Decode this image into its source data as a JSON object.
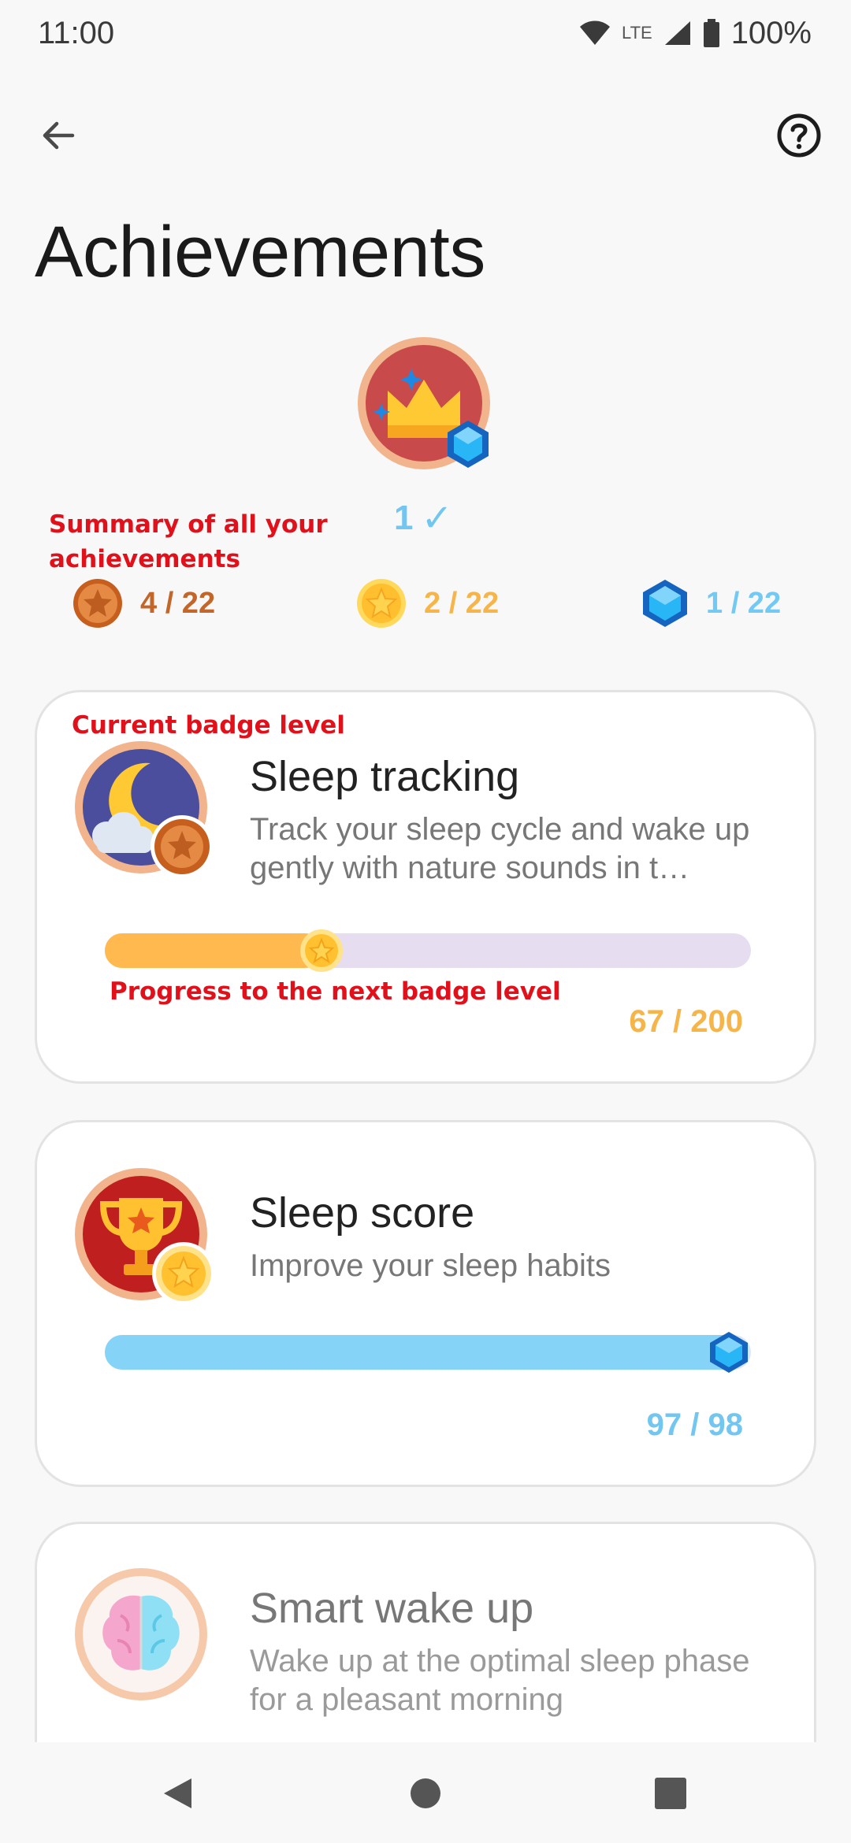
{
  "status_bar": {
    "time": "11:00",
    "network": "LTE",
    "battery": "100%",
    "icons": [
      "wifi-icon",
      "lte-icon",
      "signal-icon",
      "battery-icon"
    ]
  },
  "header": {
    "back_icon": "arrow-left-icon",
    "help_icon": "help-circle-icon",
    "title": "Achievements"
  },
  "hero": {
    "badge_icon": "crown-with-diamond-icon",
    "count": "1",
    "check": "✓"
  },
  "annotations": {
    "summary": "Summary of all your achievements",
    "current_level": "Current badge level",
    "progress": "Progress to the next badge level"
  },
  "summary": {
    "bronze": {
      "icon": "bronze-star-medal-icon",
      "value": "4 / 22",
      "color": "#c2662a"
    },
    "gold": {
      "icon": "gold-star-medal-icon",
      "value": "2 / 22",
      "color": "#f6b54a"
    },
    "diamond": {
      "icon": "diamond-icon",
      "value": "1 / 22",
      "color": "#72c9f3"
    }
  },
  "achievements": [
    {
      "title": "Sleep tracking",
      "description": "Track your sleep cycle and wake up gently with nature sounds in t…",
      "icon": "moon-cloud-icon",
      "badge_level": "bronze",
      "progress_text": "67 / 200",
      "progress_fraction": 0.335,
      "progress_color": "#ffb94f"
    },
    {
      "title": "Sleep score",
      "description": "Improve your sleep habits",
      "icon": "trophy-icon",
      "badge_level": "gold",
      "progress_text": "97 / 98",
      "progress_fraction": 0.99,
      "progress_color": "#86d3f8"
    },
    {
      "title": "Smart wake up",
      "description": "Wake up at the optimal sleep phase for a pleasant morning",
      "icon": "brain-icon",
      "badge_level": "none"
    }
  ],
  "nav": {
    "back_icon": "nav-back-icon",
    "home_icon": "nav-home-icon",
    "recents_icon": "nav-recents-icon"
  }
}
